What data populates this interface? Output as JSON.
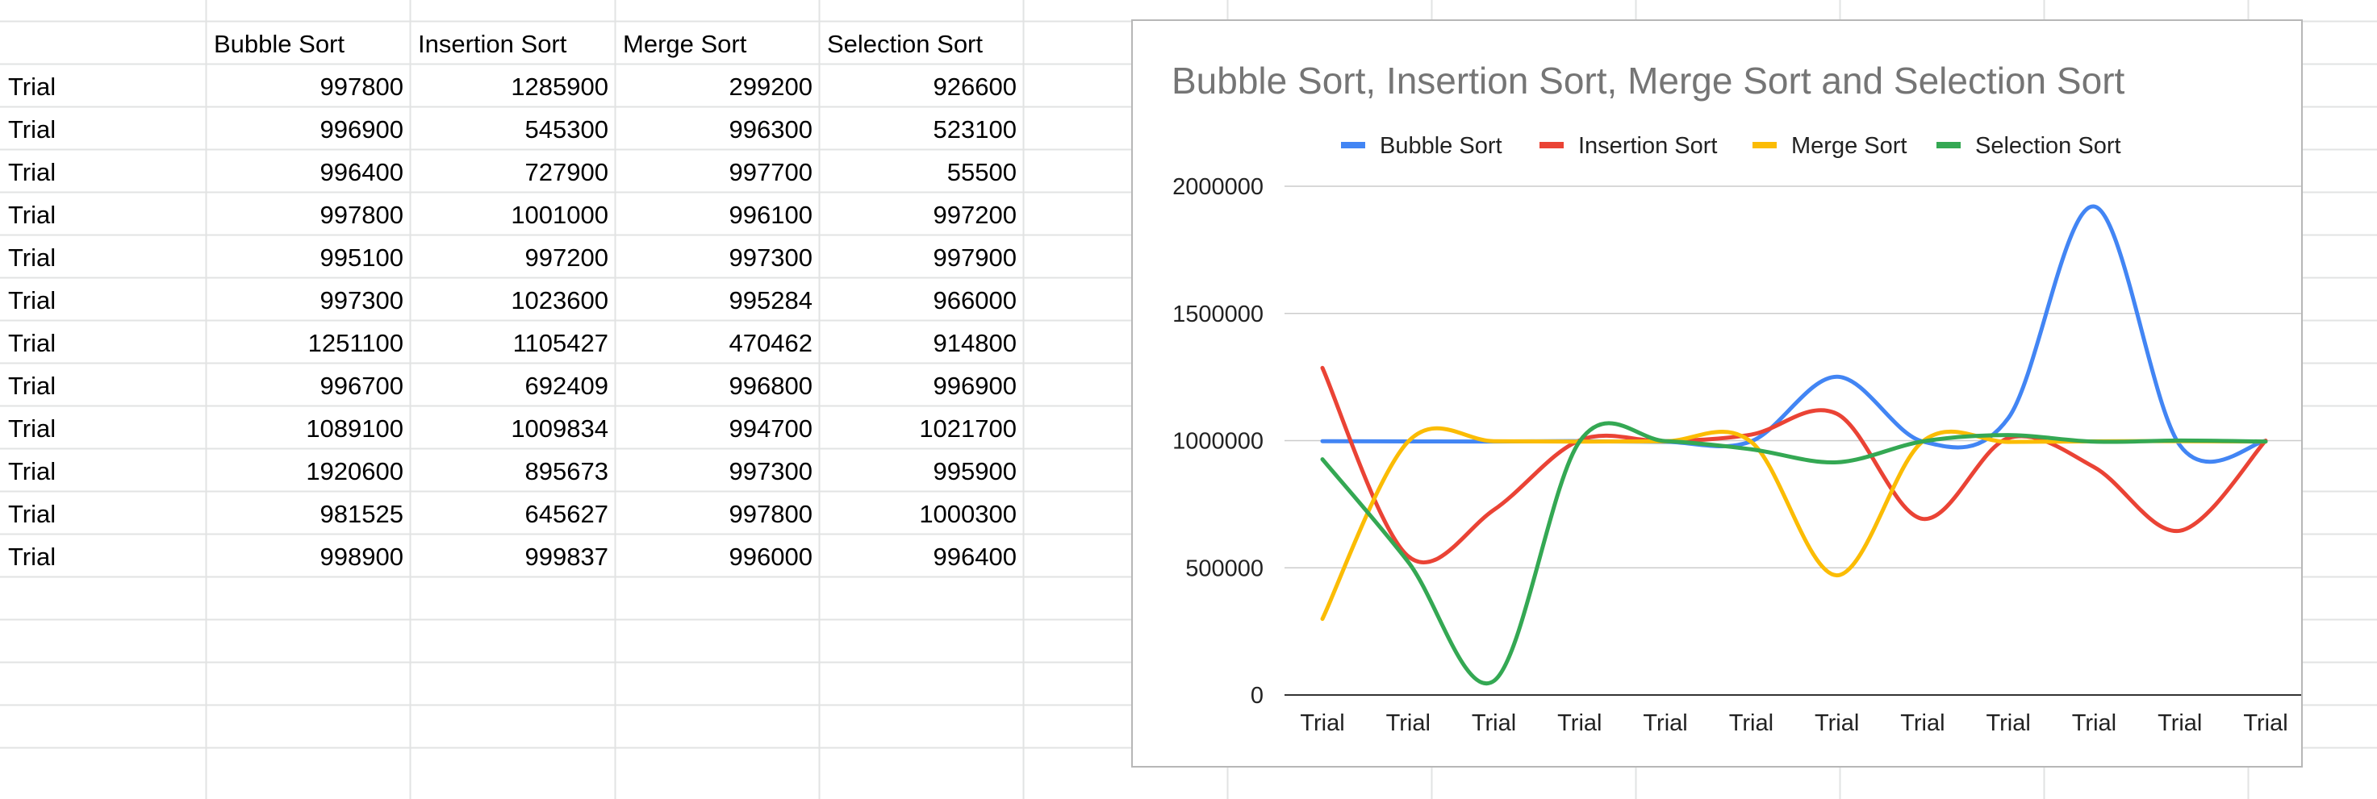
{
  "sheet": {
    "headers": [
      "",
      "Bubble Sort",
      "Insertion Sort",
      "Merge Sort",
      "Selection Sort"
    ],
    "rows": [
      [
        "Trial",
        "997800",
        "1285900",
        "299200",
        "926600"
      ],
      [
        "Trial",
        "996900",
        "545300",
        "996300",
        "523100"
      ],
      [
        "Trial",
        "996400",
        "727900",
        "997700",
        "55500"
      ],
      [
        "Trial",
        "997800",
        "1001000",
        "996100",
        "997200"
      ],
      [
        "Trial",
        "995100",
        "997200",
        "997300",
        "997900"
      ],
      [
        "Trial",
        "997300",
        "1023600",
        "995284",
        "966000"
      ],
      [
        "Trial",
        "1251100",
        "1105427",
        "470462",
        "914800"
      ],
      [
        "Trial",
        "996700",
        "692409",
        "996800",
        "996900"
      ],
      [
        "Trial",
        "1089100",
        "1009834",
        "994700",
        "1021700"
      ],
      [
        "Trial",
        "1920600",
        "895673",
        "997300",
        "995900"
      ],
      [
        "Trial",
        "981525",
        "645627",
        "997800",
        "1000300"
      ],
      [
        "Trial",
        "998900",
        "999837",
        "996000",
        "996400"
      ]
    ]
  },
  "chart_data": {
    "type": "line",
    "title": "Bubble Sort, Insertion Sort, Merge Sort and Selection Sort",
    "xlabel": "",
    "ylabel": "",
    "categories": [
      "Trial",
      "Trial",
      "Trial",
      "Trial",
      "Trial",
      "Trial",
      "Trial",
      "Trial",
      "Trial",
      "Trial",
      "Trial",
      "Trial"
    ],
    "ylim": [
      0,
      2000000
    ],
    "yticks": [
      "0",
      "500000",
      "1000000",
      "1500000",
      "2000000"
    ],
    "grid": true,
    "smooth": true,
    "legend_position": "top",
    "series": [
      {
        "name": "Bubble Sort",
        "color": "#4285f4",
        "values": [
          997800,
          996900,
          996400,
          997800,
          995100,
          997300,
          1251100,
          996700,
          1089100,
          1920600,
          981525,
          998900
        ]
      },
      {
        "name": "Insertion Sort",
        "color": "#ea4335",
        "values": [
          1285900,
          545300,
          727900,
          1001000,
          997200,
          1023600,
          1105427,
          692409,
          1009834,
          895673,
          645627,
          999837
        ]
      },
      {
        "name": "Merge Sort",
        "color": "#fbbc04",
        "values": [
          299200,
          996300,
          997700,
          996100,
          997300,
          995284,
          470462,
          996800,
          994700,
          997300,
          997800,
          996000
        ]
      },
      {
        "name": "Selection Sort",
        "color": "#34a853",
        "values": [
          926600,
          523100,
          55500,
          997200,
          997900,
          966000,
          914800,
          996900,
          1021700,
          995900,
          1000300,
          996400
        ]
      }
    ]
  }
}
